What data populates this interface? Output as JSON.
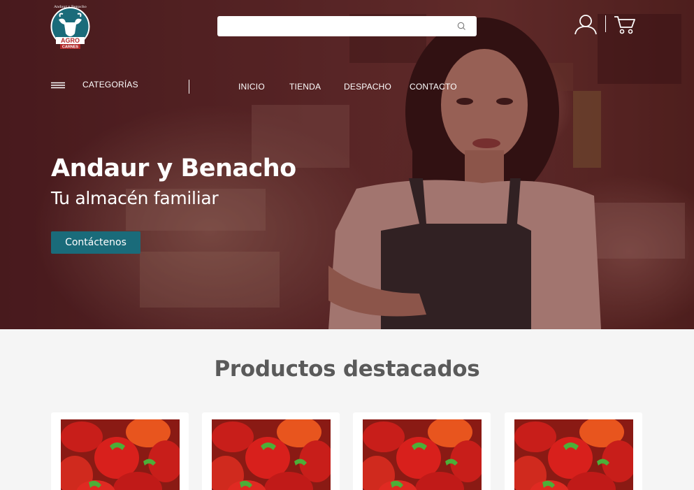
{
  "logo": {
    "top_text": "Andaur y Benacho",
    "brand": "AGRO",
    "sub": "CARNES"
  },
  "search": {
    "value": "",
    "placeholder": ""
  },
  "icons": {
    "search": "search-icon",
    "user": "user-icon",
    "cart": "cart-icon",
    "menu": "hamburger-menu-icon"
  },
  "nav": {
    "categories_label": "CATEGORÍAS",
    "links": [
      "INICIO",
      "TIENDA",
      "DESPACHO",
      "CONTACTO"
    ]
  },
  "hero": {
    "title": "Andaur y Benacho",
    "subtitle": "Tu almacén familiar",
    "cta_label": "Contáctenos"
  },
  "featured": {
    "title": "Productos destacados",
    "products": [
      {
        "image": "red-peppers"
      },
      {
        "image": "red-peppers"
      },
      {
        "image": "red-peppers"
      },
      {
        "image": "red-peppers"
      }
    ]
  },
  "colors": {
    "hero_overlay": "#4a1c1f",
    "accent": "#1a6b7a",
    "title_gray": "#5a5a5a",
    "page_bg": "#f5f5f5"
  }
}
